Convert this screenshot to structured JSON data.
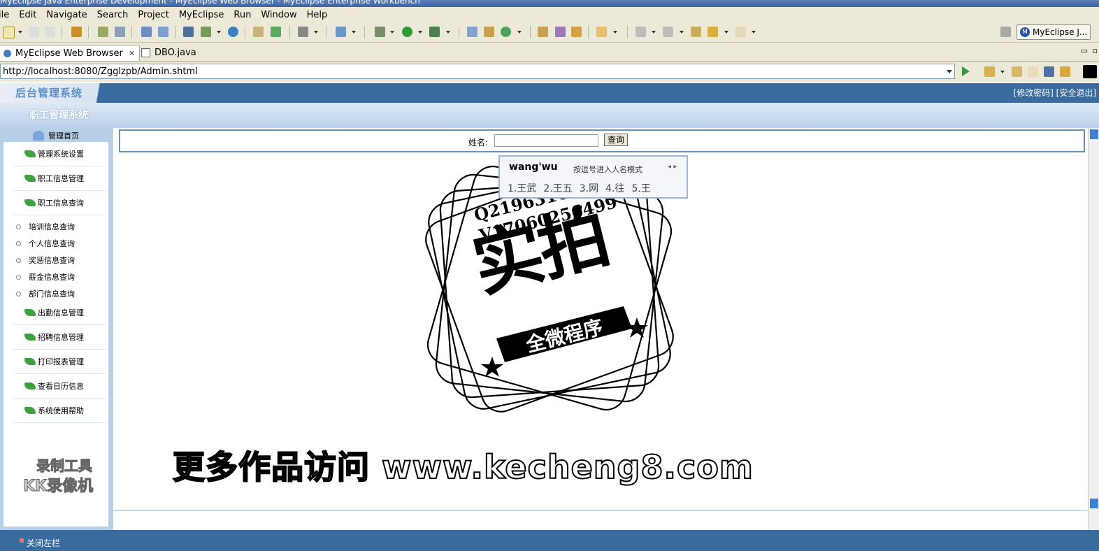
{
  "window": {
    "title": "MyEclipse Java Enterprise Development - MyEclipse Web Browser - MyEclipse Enterprise Workbench"
  },
  "menubar": [
    "ile",
    "Edit",
    "Navigate",
    "Search",
    "Project",
    "MyEclipse",
    "Run",
    "Window",
    "Help"
  ],
  "toolbar": {
    "perspective_label": "MyEclipse J...",
    "perspective_icon_letter": "M"
  },
  "tabs": [
    {
      "label": "MyEclipse Web Browser",
      "close": "✕"
    },
    {
      "label": "DBO.java"
    }
  ],
  "browser": {
    "url": "http://localhost:8080/Zgglzpb/Admin.shtml"
  },
  "app": {
    "logo_text": "后台管理系统",
    "header_links": "[修改密码] [安全退出]",
    "subtitle": "职工管理系统",
    "nav_home": "管理首页",
    "nav_groups": [
      {
        "label": "管理系统设置"
      },
      {
        "label": "职工信息管理"
      },
      {
        "label": "职工信息查询"
      }
    ],
    "nav_subitems": [
      "培训信息查询",
      "个人信息查询",
      "奖惩信息查询",
      "薪金信息查询",
      "部门信息查询"
    ],
    "nav_groups_2": [
      {
        "label": "出勤信息管理"
      },
      {
        "label": "招聘信息管理"
      },
      {
        "label": "打印报表管理"
      },
      {
        "label": "查看日历信息"
      },
      {
        "label": "系统使用帮助"
      }
    ],
    "search": {
      "label": "姓名:",
      "value": "",
      "button": "查询"
    },
    "footer_label": "关闭左栏"
  },
  "ime": {
    "typed": "wang'wu",
    "hint": "按逗号进入人名模式",
    "arrows": "◂ ▸",
    "candidates": [
      "1.王武",
      "2.王五",
      "3.网",
      "4.往",
      "5.王"
    ]
  },
  "watermarks": {
    "recorder_line1": "录制工具",
    "recorder_line2": "KK录像机",
    "stamp_line1": "Q2196316269",
    "stamp_line2": "V17060256499",
    "stamp_main": "实拍",
    "stamp_banner": "全微程序",
    "site": "更多作品访问 www.kecheng8.com"
  },
  "colors": {
    "header_blue": "#3a6b9e",
    "sidebar_blue": "#b8cfe8",
    "nav_icon_green": "#3da13d",
    "eclipse_chrome": "#ece9d8"
  }
}
